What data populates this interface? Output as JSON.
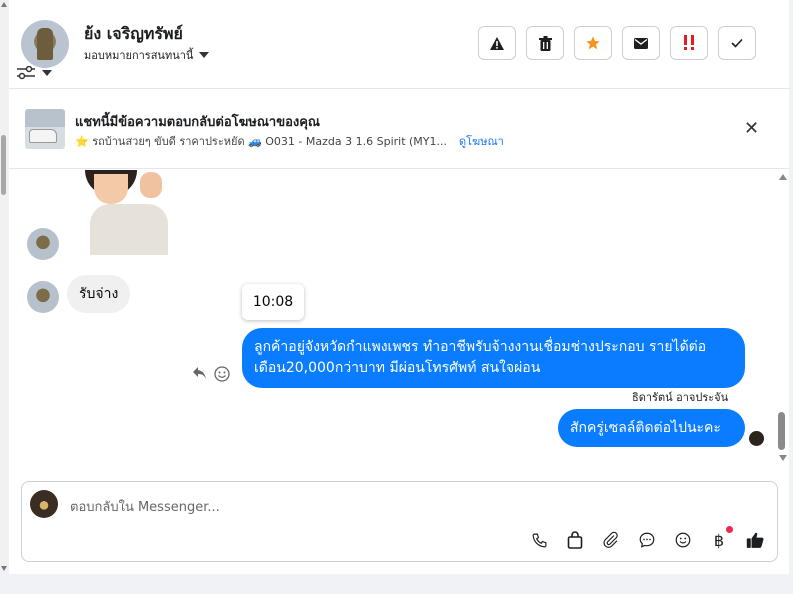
{
  "header": {
    "contact_name": "ย้ง เจริญทรัพย์",
    "assign_label": "มอบหมายการสนทนานี้"
  },
  "actions": [
    {
      "name": "warning",
      "icon": "warning-icon"
    },
    {
      "name": "trash",
      "icon": "trash-icon"
    },
    {
      "name": "star",
      "icon": "star-icon",
      "color": "#f7931e"
    },
    {
      "name": "mail",
      "icon": "mail-icon"
    },
    {
      "name": "urgent",
      "icon": "double-exclaim-icon",
      "color": "#e02020"
    },
    {
      "name": "done",
      "icon": "check-icon"
    }
  ],
  "ad": {
    "title": "แชทนี้มีข้อความตอบกลับต่อโฆษณาของคุณ",
    "subtitle": "⭐ รถบ้านสวยๆ ขับดี ราคาประหยัด 🚙 O031 - Mazda 3 1.6 Spirit (MY1...",
    "link": "ดูโฆษณา"
  },
  "messages": {
    "incoming_text": "รับจ่าง",
    "time": "10:08",
    "outgoing_1": "ลูกค้าอยู่จังหวัดกำแพงเพชร ทำอาชีพรับจ้างงานเชื่อมช่างประกอบ รายได้ต่อเดือน20,000กว่าบาท  มีผ่อนโทรศัพท์ สนใจผ่อน",
    "sender_name": "ธิดารัตน์ อาจประจัน",
    "outgoing_2": "สักครู่เซลล์ติดต่อไปนะคะ"
  },
  "composer": {
    "placeholder": "ตอบกลับใน Messenger..."
  },
  "colors": {
    "accent": "#0a7cff",
    "star": "#f7931e",
    "urgent": "#e02020",
    "badge": "#f02849"
  }
}
